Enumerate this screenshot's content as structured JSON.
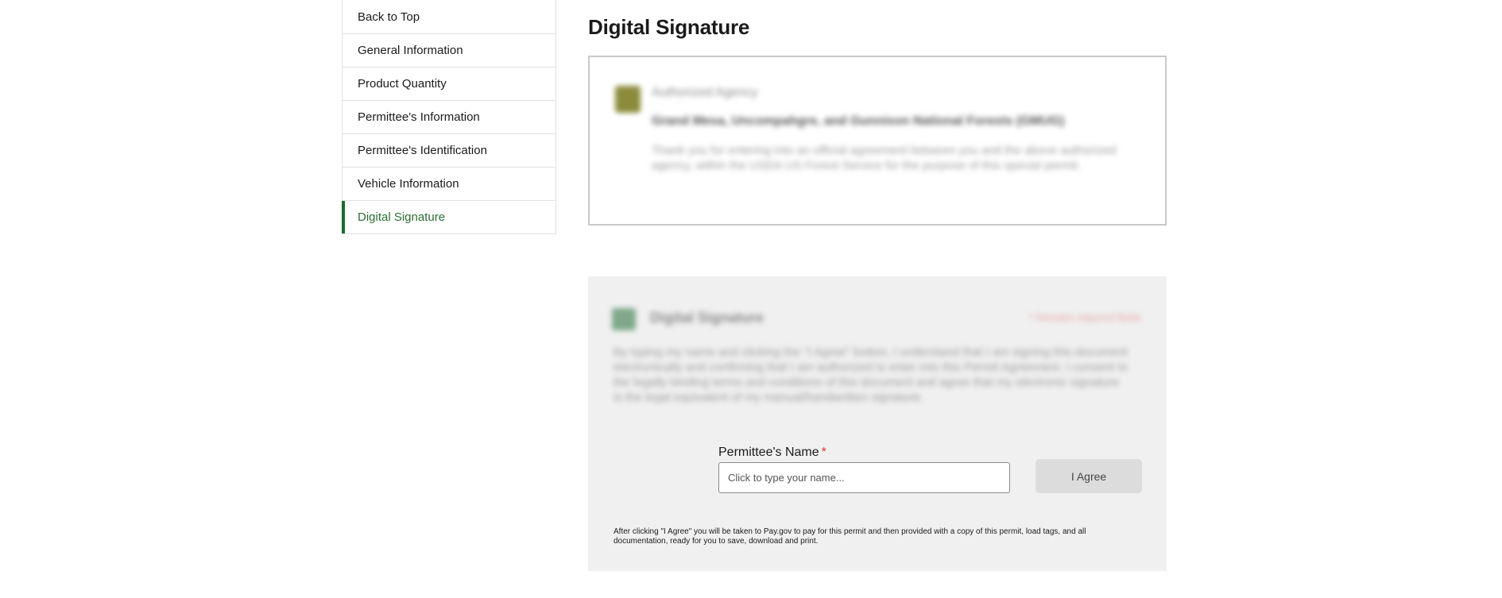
{
  "sidebar": {
    "items": [
      {
        "label": "Back to Top"
      },
      {
        "label": "General Information"
      },
      {
        "label": "Product Quantity"
      },
      {
        "label": "Permittee's Information"
      },
      {
        "label": "Permittee's Identification"
      },
      {
        "label": "Vehicle Information"
      },
      {
        "label": "Digital Signature",
        "active": true
      }
    ]
  },
  "main": {
    "title": "Digital Signature",
    "agency": {
      "label": "Authorized Agency",
      "name": "Grand Mesa, Uncompahgre, and Gunnison National Forests (GMUG)",
      "description": "Thank you for entering into an official agreement between you and the above authorized agency, within the USDA US Forest Service for the purpose of this special permit."
    },
    "signature": {
      "heading": "Digital Signature",
      "required_note": "* Denotes required fields",
      "agreement_text": "By typing my name and clicking the \"I Agree\" button, I understand that I am signing this document electronically and confirming that I am authorized to enter into this Permit Agreement. I consent to the legally binding terms and conditions of this document and agree that my electronic signature is the legal equivalent of my manual/handwritten signature.",
      "name_label": "Permittee's Name",
      "required_marker": "*",
      "name_placeholder": "Click to type your name...",
      "agree_label": "I Agree",
      "footnote": "After clicking \"I Agree\" you will be taken to Pay.gov to pay for this permit and then provided with a copy of this permit, load tags, and all documentation, ready for you to save, download and print."
    }
  },
  "colors": {
    "accent_green": "#1a6b2e",
    "active_text": "#2e6f33",
    "required_red": "#d83933",
    "panel_bg": "#f0f0f0"
  }
}
